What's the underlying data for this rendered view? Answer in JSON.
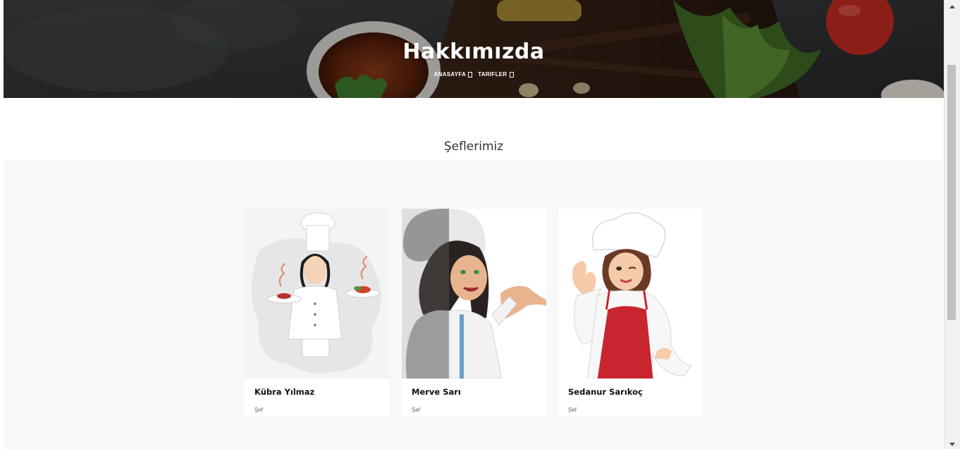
{
  "hero": {
    "title": "Hakkımızda",
    "breadcrumb": [
      {
        "label": "ANASAYFA"
      },
      {
        "label": "TARIFLER"
      }
    ]
  },
  "section": {
    "title": "Şeflerimiz"
  },
  "chefs": [
    {
      "name": "Kübra Yılmaz",
      "role": "Şef"
    },
    {
      "name": "Merve Sarı",
      "role": "Şef"
    },
    {
      "name": "Sedanur Sarıkoç",
      "role": "Şef"
    }
  ],
  "colors": {
    "hero_bg": "#2f3133",
    "team_bg": "#f8f8f8",
    "apron_red": "#c9252f"
  }
}
